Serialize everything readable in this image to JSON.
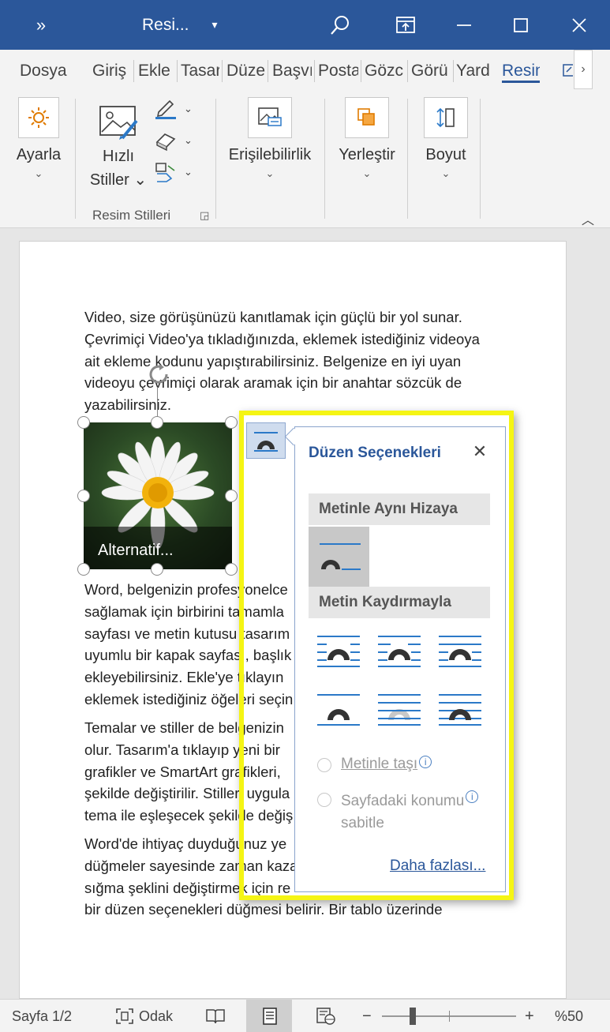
{
  "titlebar": {
    "more": "»",
    "title": "Resi...",
    "caret": "▾",
    "icons": [
      "search-icon",
      "display-options-icon",
      "minimize-icon",
      "maximize-icon",
      "close-icon"
    ],
    "color": "#2b579a"
  },
  "tabs": [
    {
      "label": "Dosya"
    },
    {
      "label": "Giriş"
    },
    {
      "label": "Ekle"
    },
    {
      "label": "Tasar"
    },
    {
      "label": "Düze"
    },
    {
      "label": "Başvı"
    },
    {
      "label": "Posta"
    },
    {
      "label": "Gözc"
    },
    {
      "label": "Görü"
    },
    {
      "label": "Yard"
    },
    {
      "label": "Resim",
      "active": true
    }
  ],
  "ribbon": {
    "adjust": {
      "label": "Ayarla",
      "caret": "⌄"
    },
    "quick_styles": {
      "label1": "Hızlı",
      "label2": "Stiller ⌄"
    },
    "group_label": "Resim Stilleri",
    "accessibility": {
      "label": "Erişilebilirlik",
      "caret": "⌄"
    },
    "arrange": {
      "label": "Yerleştir",
      "caret": "⌄"
    },
    "size": {
      "label": "Boyut",
      "caret": "⌄"
    }
  },
  "document": {
    "para1": [
      "Video, size görüşünüzü kanıtlamak için güçlü bir yol sunar.",
      "Çevrimiçi Video'ya tıkladığınızda, eklemek istediğiniz videoya",
      "ait ekleme kodunu yapıştırabilirsiniz. Belgenize en iyi uyan",
      "videoyu çevrimiçi olarak aramak için bir anahtar sözcük de",
      "yazabilirsiniz."
    ],
    "para2": [
      "Word, belgenizin profesyonelce",
      "sağlamak için birbirini tamamla",
      "sayfası ve metin kutusu tasarım",
      "uyumlu bir kapak sayfası, başlık",
      "ekleyebilirsiniz. Ekle'ye tıklayın",
      "eklemek istediğiniz öğeleri seçin"
    ],
    "para3": [
      "Temalar ve stiller de belgenizin",
      "olur. Tasarım'a tıklayıp yeni bir",
      "grafikler ve SmartArt grafikleri,",
      "şekilde değiştirilir. Stilleri uygula",
      "tema ile eşleşecek şekilde değiş"
    ],
    "para4": [
      "Word'de ihtiyaç duyduğunuz ye",
      "düğmeler sayesinde zaman kaza",
      "sığma şeklini değiştirmek için re",
      "bir düzen seçenekleri düğmesi belirir. Bir tablo üzerinde"
    ],
    "image_alt": "Alternatif..."
  },
  "layout_popup": {
    "title": "Düzen Seçenekleri",
    "close": "✕",
    "inline_section": "Metinle Aynı Hizaya",
    "wrap_section": "Metin Kaydırmayla",
    "move_with_text": "Metinle taşı",
    "fix_position": "Sayfadaki konumu",
    "fix_position_2": "sabitle",
    "more": "Daha fazlası..."
  },
  "statusbar": {
    "page": "Sayfa 1/2",
    "focus": "Odak",
    "zoom_minus": "−",
    "zoom_plus": "+",
    "zoom": "%50"
  }
}
